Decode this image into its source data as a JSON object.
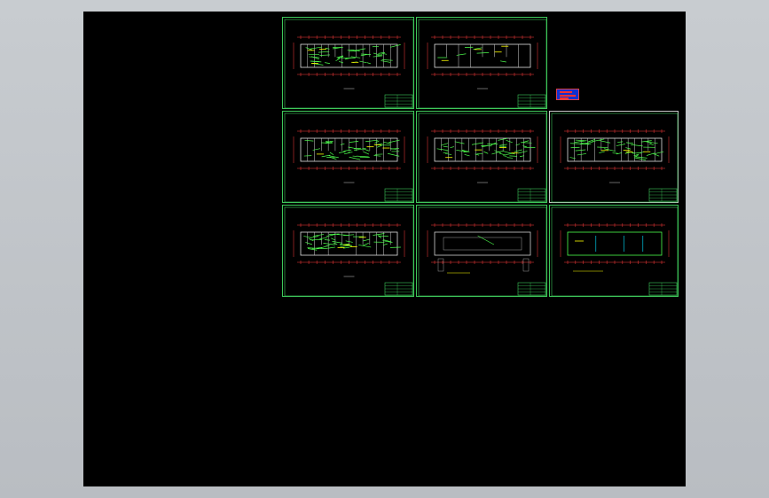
{
  "window": {
    "background_color": "#c0c4c8",
    "canvas_color": "#000000"
  },
  "drawing": {
    "frame_color": "#3ec85a",
    "plan_color": "#4dff4d",
    "dim_color": "#ff3c3c",
    "accent_color": "#ffff00",
    "sheets": [
      {
        "id": "1",
        "kind": "plan-dense"
      },
      {
        "id": "2",
        "kind": "plan-walls"
      },
      {
        "id": "3",
        "kind": "plan-dense"
      },
      {
        "id": "4",
        "kind": "plan-dense"
      },
      {
        "id": "5",
        "kind": "plan-dense"
      },
      {
        "id": "6",
        "kind": "plan-dense"
      },
      {
        "id": "7",
        "kind": "roof"
      },
      {
        "id": "8",
        "kind": "elevation"
      }
    ]
  }
}
